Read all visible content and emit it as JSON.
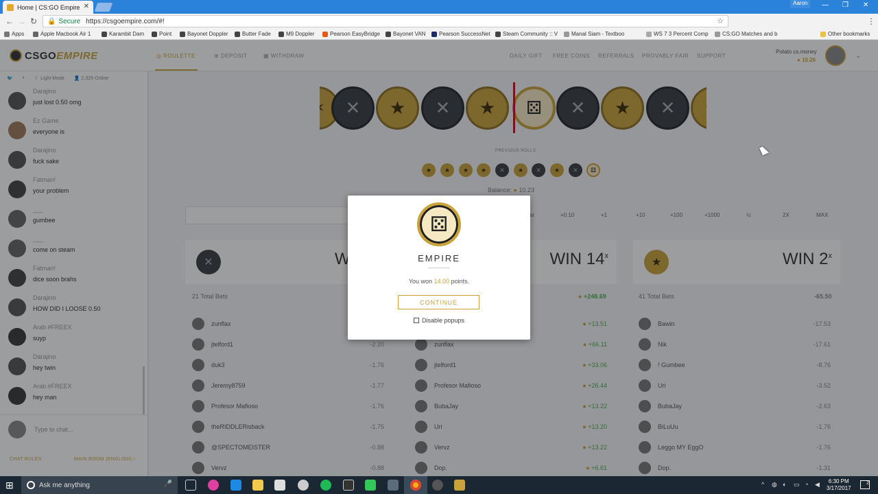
{
  "browser": {
    "tab_title": "Home | CS:GO Empire",
    "secure_label": "Secure",
    "url": "https://csgoempire.com/#!",
    "profile_name": "Aaron",
    "bookmarks": [
      "Apps",
      "Apple Macbook Air 1",
      "Karambit Dam",
      "Point",
      "Bayonet Doppler",
      "Butter Fade",
      "M9 Doppler",
      "Pearson EasyBridge",
      "Bayonet VAN",
      "Pearson SuccessNet",
      "Steam Community :: V",
      "Manal Siam - Textboo",
      "WS 7 3 Percent Comp",
      "CS:GO Matches and b",
      "Other bookmarks"
    ]
  },
  "site": {
    "logo_a": "CSGO",
    "logo_b": "EMPIRE",
    "nav_left": [
      "ROULETTE",
      "DEPOSIT",
      "WITHDRAW"
    ],
    "nav_right": [
      "DAILY GIFT",
      "FREE COINS",
      "REFERRALS",
      "PROVABLY FAIR",
      "SUPPORT"
    ],
    "user_name": "Potato cs.money",
    "user_balance": "10.26"
  },
  "sidebar": {
    "mode_label": "Light Mode",
    "online_label": "2,329 Online",
    "messages": [
      {
        "name": "Darajino",
        "text": "just lost 0.50 omg"
      },
      {
        "name": "Ez Game",
        "text": "everyone is"
      },
      {
        "name": "Darajino",
        "text": "fuck sake"
      },
      {
        "name": "Fatman!",
        "text": "your problem"
      },
      {
        "name": "___",
        "text": "gumbee"
      },
      {
        "name": "___",
        "text": "come on steam"
      },
      {
        "name": "Fatman!",
        "text": "dice soon brahs"
      },
      {
        "name": "Darajino",
        "text": "HOW DID I LOOSE 0.50"
      },
      {
        "name": "Arab #FREEX",
        "text": "suyp"
      },
      {
        "name": "Darajino",
        "text": "hey twin"
      },
      {
        "name": "Arab #FREEX",
        "text": "hey man"
      }
    ],
    "chat_placeholder": "Type to chat...",
    "chat_rules": "CHAT RULES",
    "main_room": "MAIN ROOM (ENGLISH)"
  },
  "game": {
    "strip": [
      "gold",
      "dark",
      "gold",
      "dark",
      "gold",
      "dice",
      "dark",
      "gold",
      "dark",
      "gold"
    ],
    "previous_label": "PREVIOUS ROLLS",
    "previous_rolls": [
      "gold",
      "gold",
      "gold",
      "gold",
      "dark",
      "gold",
      "dark",
      "gold",
      "dark",
      "dice"
    ],
    "balance_label": "Balance:",
    "balance": "10.23",
    "bet_buttons": [
      "Clear",
      "+0.10",
      "+1",
      "+10",
      "+100",
      "+1000",
      "½",
      "2X",
      "MAX"
    ],
    "panels": [
      {
        "win": "WIN 2",
        "total_bets": "21 Total Bets",
        "total": ""
      },
      {
        "win": "WIN 14",
        "total_bets": "",
        "total": "+248.69"
      },
      {
        "win": "WIN 2",
        "total_bets": "41 Total Bets",
        "total": "-65.50"
      }
    ],
    "multiplier_sup": "x",
    "left_bets": [
      {
        "name": "zunflax",
        "amount": ""
      },
      {
        "name": "jtelford1",
        "amount": "-2.20"
      },
      {
        "name": "duk3",
        "amount": "-1.76"
      },
      {
        "name": "Jeremy8759",
        "amount": "-1.77"
      },
      {
        "name": "Profesor Mafioso",
        "amount": "-1.76"
      },
      {
        "name": "theRIDDLERisback",
        "amount": "-1.75"
      },
      {
        "name": "@SPECTOMEISTER",
        "amount": "-0.88"
      },
      {
        "name": "Vervz",
        "amount": "-0.88"
      }
    ],
    "mid_bets": [
      {
        "name": "",
        "amount": "+13.51"
      },
      {
        "name": "zunflax",
        "amount": "+66.11"
      },
      {
        "name": "jtelford1",
        "amount": "+33.06"
      },
      {
        "name": "Profesor Mafioso",
        "amount": "+26.44"
      },
      {
        "name": "BubaJay",
        "amount": "+13.22"
      },
      {
        "name": "Uri",
        "amount": "+13.20"
      },
      {
        "name": "Vervz",
        "amount": "+13.22"
      },
      {
        "name": "Dop.",
        "amount": "+6.61"
      }
    ],
    "right_bets": [
      {
        "name": "Bawin",
        "amount": "-17.53"
      },
      {
        "name": "Nik",
        "amount": "-17.61"
      },
      {
        "name": "! Gumbee",
        "amount": "-8.76"
      },
      {
        "name": "Uri",
        "amount": "-3.52"
      },
      {
        "name": "BubaJay",
        "amount": "-2.63"
      },
      {
        "name": "BiLuUu",
        "amount": "-1.76"
      },
      {
        "name": "Leggo MY EggO",
        "amount": "-1.76"
      },
      {
        "name": "Dop.",
        "amount": "-1.31"
      }
    ]
  },
  "modal": {
    "title": "EMPIRE",
    "text_before": "You won",
    "points": "14.00",
    "text_after": "points.",
    "continue_label": "CONTINUE",
    "checkbox_label": "Disable popups"
  },
  "taskbar": {
    "search_placeholder": "Ask me anything",
    "time": "6:30 PM",
    "date": "3/17/2017",
    "notification_count": "2"
  },
  "colors": {
    "gold": "#c9a33a",
    "dark_coin": "#3a3d43",
    "positive": "#4caf50",
    "marker": "#c01818"
  }
}
